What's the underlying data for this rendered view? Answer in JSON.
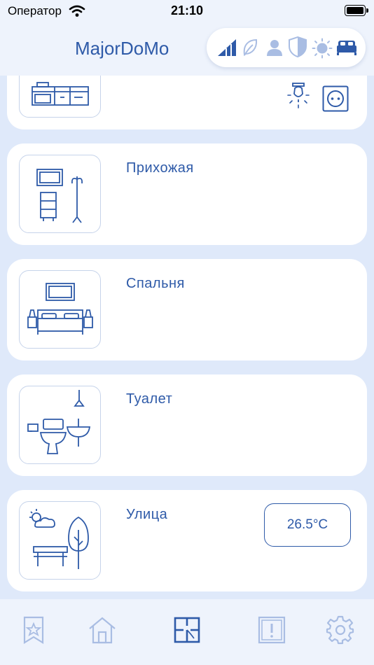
{
  "status_bar": {
    "carrier": "Оператор",
    "time": "21:10"
  },
  "header": {
    "title": "MajorDoMo",
    "mode_icons": [
      "signal-icon",
      "eco-leaf-icon",
      "person-icon",
      "security-shield-icon",
      "sun-icon",
      "bed-icon"
    ]
  },
  "rooms": [
    {
      "name": "",
      "icons": [
        "ceiling-lamp-icon",
        "power-socket-icon"
      ]
    },
    {
      "name": "Прихожая"
    },
    {
      "name": "Спальня"
    },
    {
      "name": "Туалет"
    },
    {
      "name": "Улица",
      "temperature": "26.5°C"
    }
  ],
  "tabbar": {
    "tabs": [
      "favorites-icon",
      "home-icon",
      "floor-plan-icon",
      "alert-icon",
      "settings-icon"
    ],
    "active": "floor-plan-icon"
  },
  "colors": {
    "accent": "#2e5aa8",
    "muted": "#a9bde3",
    "background": "#dfe9fa"
  }
}
